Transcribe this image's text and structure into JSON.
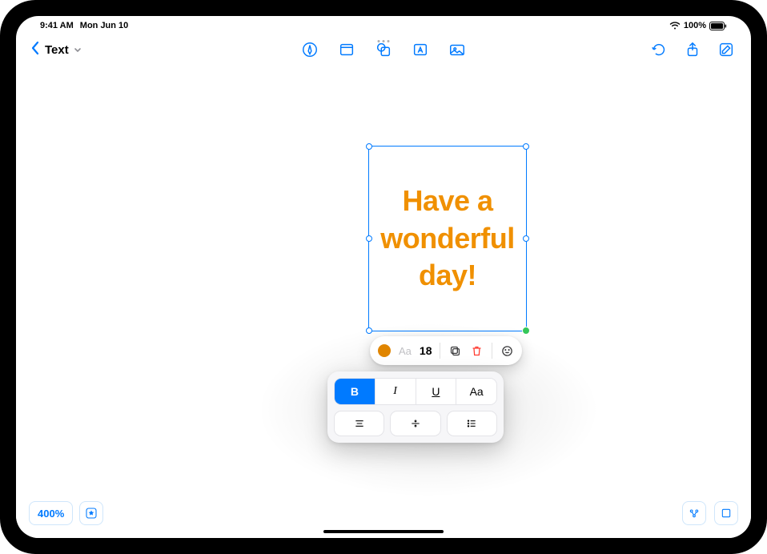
{
  "status": {
    "time": "9:41 AM",
    "date": "Mon Jun 10",
    "battery": "100%"
  },
  "toolbar": {
    "tool_label": "Text"
  },
  "textbox": {
    "content": "Have a wonderful day!",
    "color": "#f09000"
  },
  "inline_toolbar": {
    "font_label": "Aa",
    "font_size": "18"
  },
  "format": {
    "bold": "B",
    "italic": "I",
    "underline": "U",
    "caps": "Aa"
  },
  "zoom": {
    "level": "400%"
  }
}
